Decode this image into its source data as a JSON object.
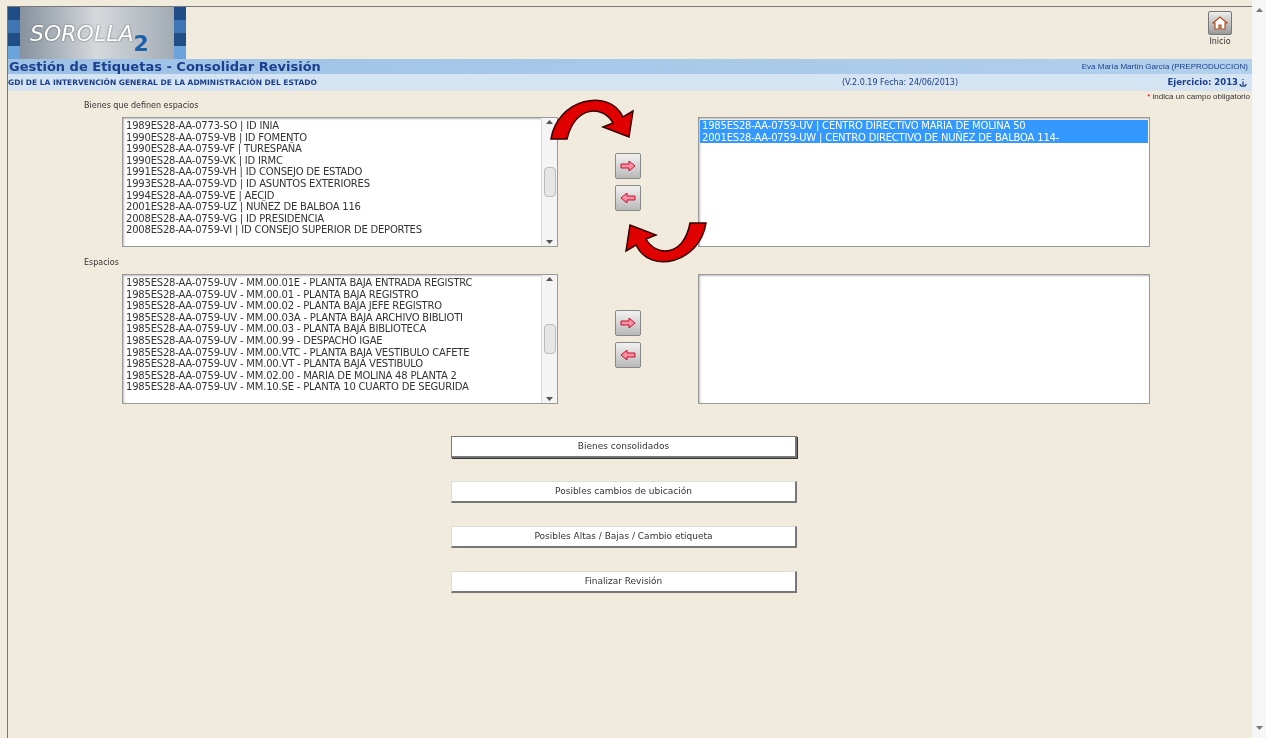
{
  "header": {
    "logo": "SOROLLA",
    "logo_number": "2",
    "home_label": "Inicio"
  },
  "title_bar": {
    "title": "Gestión de Etiquetas - Consolidar Revisión",
    "user": "Eva María Martín García (PREPRODUCCION)"
  },
  "sub_bar": {
    "organization": "GDI DE LA INTERVENCIÓN GENERAL DE LA ADMINISTRACIÓN DEL ESTADO",
    "version": "(V.2.0.19 Fecha: 24/06/2013)",
    "year": "Ejercicio: 2013"
  },
  "required_note": {
    "mark": "*",
    "text": "indica un campo obligatorio"
  },
  "sections": [
    {
      "label": "Bienes que definen espacios",
      "available": [
        {
          "text": "1989ES28-AA-0773-SO | ID INIA",
          "selected": false
        },
        {
          "text": "1990ES28-AA-0759-VB | ID FOMENTO",
          "selected": false
        },
        {
          "text": "1990ES28-AA-0759-VF | TURESPAÑA",
          "selected": false
        },
        {
          "text": "1990ES28-AA-0759-VK | ID IRMC",
          "selected": false
        },
        {
          "text": "1991ES28-AA-0759-VH | ID CONSEJO DE ESTADO",
          "selected": false
        },
        {
          "text": "1993ES28-AA-0759-VD | ID ASUNTOS EXTERIORES",
          "selected": false
        },
        {
          "text": "1994ES28-AA-0759-VE | AECID",
          "selected": false
        },
        {
          "text": "2001ES28-AA-0759-UZ | NUÑEZ DE BALBOA 116",
          "selected": false
        },
        {
          "text": "2008ES28-AA-0759-VG | ID PRESIDENCIA",
          "selected": false
        },
        {
          "text": "2008ES28-AA-0759-VI | ID CONSEJO SUPERIOR DE DEPORTES",
          "selected": false
        }
      ],
      "chosen": [
        {
          "text": "1985ES28-AA-0759-UV | CENTRO DIRECTIVO MARIA DE MOLINA 50",
          "selected": true
        },
        {
          "text": "2001ES28-AA-0759-UW | CENTRO DIRECTIVO DE NUÑEZ DE BALBOA 114-",
          "selected": true
        }
      ],
      "curved_arrows": true
    },
    {
      "label": "Espacios",
      "available": [
        {
          "text": "1985ES28-AA-0759-UV - MM.00.01E - PLANTA BAJA ENTRADA REGISTRC",
          "selected": false
        },
        {
          "text": "1985ES28-AA-0759-UV - MM.00.01 - PLANTA BAJA  REGISTRO",
          "selected": false
        },
        {
          "text": "1985ES28-AA-0759-UV - MM.00.02 - PLANTA BAJA JEFE REGISTRO",
          "selected": false
        },
        {
          "text": "1985ES28-AA-0759-UV - MM.00.03A - PLANTA BAJA  ARCHIVO BIBLIOTI",
          "selected": false
        },
        {
          "text": "1985ES28-AA-0759-UV - MM.00.03 - PLANTA BAJA BIBLIOTECA",
          "selected": false
        },
        {
          "text": "1985ES28-AA-0759-UV - MM.00.99 - DESPACHO IGAE",
          "selected": false
        },
        {
          "text": "1985ES28-AA-0759-UV - MM.00.VTC - PLANTA BAJA VESTIBULO CAFETE",
          "selected": false
        },
        {
          "text": "1985ES28-AA-0759-UV - MM.00.VT - PLANTA BAJA VESTIBULO",
          "selected": false
        },
        {
          "text": "1985ES28-AA-0759-UV - MM.02.00 - MARIA DE MOLINA 48 PLANTA 2",
          "selected": false
        },
        {
          "text": "1985ES28-AA-0759-UV - MM.10.SE - PLANTA 10 CUARTO DE SEGURIDA",
          "selected": false
        }
      ],
      "curved_arrows": false
    }
  ],
  "buttons": [
    {
      "label": "Bienes consolidados",
      "focused": true
    },
    {
      "label": "Posibles cambios de ubicación",
      "focused": false
    },
    {
      "label": "Posibles Altas / Bajas / Cambio etiqueta",
      "focused": false
    },
    {
      "label": "Finalizar Revisión",
      "focused": false
    }
  ]
}
